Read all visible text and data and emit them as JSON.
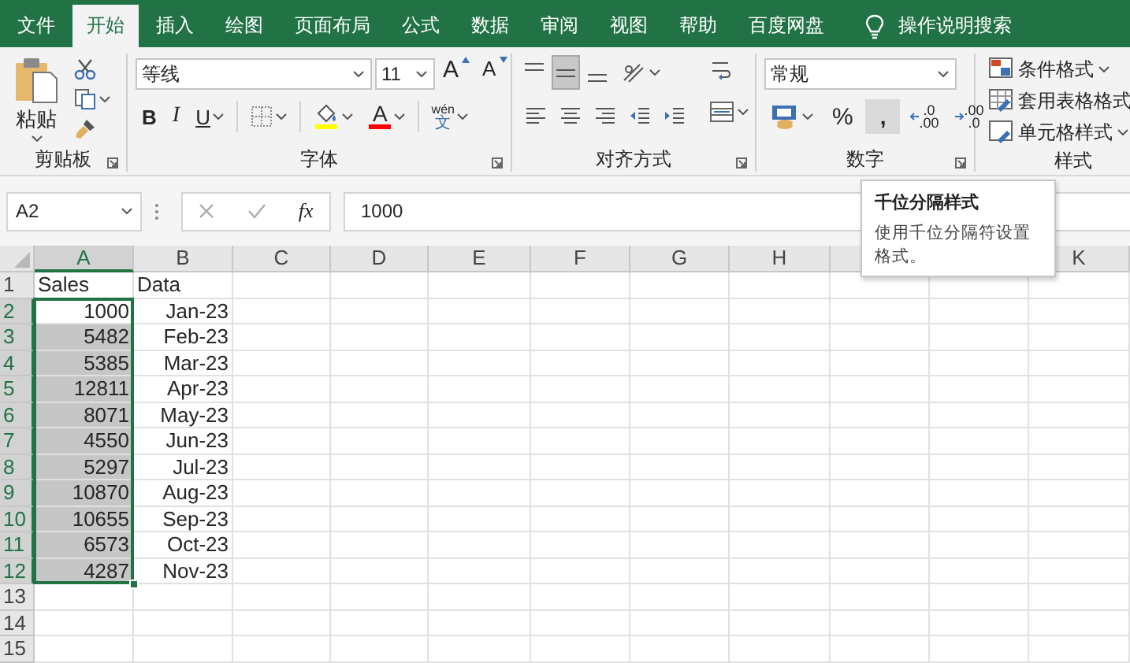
{
  "tabs": [
    {
      "label": "文件",
      "selected": false
    },
    {
      "label": "开始",
      "selected": true
    },
    {
      "label": "插入",
      "selected": false
    },
    {
      "label": "绘图",
      "selected": false
    },
    {
      "label": "页面布局",
      "selected": false
    },
    {
      "label": "公式",
      "selected": false
    },
    {
      "label": "数据",
      "selected": false
    },
    {
      "label": "审阅",
      "selected": false
    },
    {
      "label": "视图",
      "selected": false
    },
    {
      "label": "帮助",
      "selected": false
    },
    {
      "label": "百度网盘",
      "selected": false
    }
  ],
  "search": {
    "label": "操作说明搜索"
  },
  "clipboard": {
    "label": "剪贴板",
    "paste": "粘贴"
  },
  "font": {
    "label": "字体",
    "font_name": "等线",
    "font_size": "11",
    "grow": "A",
    "shrink": "A",
    "bold": "B",
    "italic": "I",
    "underline": "U",
    "font_color": "A",
    "phonetic": [
      "wén",
      "文"
    ]
  },
  "alignment": {
    "label": "对齐方式",
    "vertical_align": [
      {
        "selected": false
      },
      {
        "selected": true
      },
      {
        "selected": false
      }
    ],
    "horizontal_align": [
      {
        "selected": false
      },
      {
        "selected": false
      },
      {
        "selected": false
      }
    ]
  },
  "number": {
    "label": "数字",
    "format": "常规",
    "percent": "%",
    "comma": {
      "text": ",",
      "hovered": true
    },
    "increase_decimal": [
      ".0",
      ".00"
    ],
    "decrease_decimal": [
      ".00",
      ".0"
    ]
  },
  "styles": {
    "label": "样式",
    "items": [
      "条件格式",
      "套用表格格式",
      "单元格样式"
    ]
  },
  "name_box": "A2",
  "fx": "fx",
  "formula": "1000",
  "tooltip": {
    "title": "千位分隔样式",
    "body": "使用千位分隔符设置格式。"
  },
  "sheet": {
    "columns": [
      {
        "label": "A",
        "selected": true
      },
      {
        "label": "B",
        "selected": false
      },
      {
        "label": "C",
        "selected": false
      },
      {
        "label": "D",
        "selected": false
      },
      {
        "label": "E",
        "selected": false
      },
      {
        "label": "F",
        "selected": false
      },
      {
        "label": "G",
        "selected": false
      },
      {
        "label": "H",
        "selected": false
      }
    ],
    "last_column": "K",
    "rows": [
      {
        "number": "1",
        "selected": false,
        "active": false,
        "kind": "text",
        "cells": [
          "Sales",
          "Data"
        ]
      },
      {
        "number": "2",
        "selected": true,
        "active": true,
        "kind": "value",
        "cells": [
          "1000",
          "Jan-23"
        ]
      },
      {
        "number": "3",
        "selected": true,
        "active": false,
        "kind": "value",
        "cells": [
          "5482",
          "Feb-23"
        ]
      },
      {
        "number": "4",
        "selected": true,
        "active": false,
        "kind": "value",
        "cells": [
          "5385",
          "Mar-23"
        ]
      },
      {
        "number": "5",
        "selected": true,
        "active": false,
        "kind": "value",
        "cells": [
          "12811",
          "Apr-23"
        ]
      },
      {
        "number": "6",
        "selected": true,
        "active": false,
        "kind": "value",
        "cells": [
          "8071",
          "May-23"
        ]
      },
      {
        "number": "7",
        "selected": true,
        "active": false,
        "kind": "value",
        "cells": [
          "4550",
          "Jun-23"
        ]
      },
      {
        "number": "8",
        "selected": true,
        "active": false,
        "kind": "value",
        "cells": [
          "5297",
          "Jul-23"
        ]
      },
      {
        "number": "9",
        "selected": true,
        "active": false,
        "kind": "value",
        "cells": [
          "10870",
          "Aug-23"
        ]
      },
      {
        "number": "10",
        "selected": true,
        "active": false,
        "kind": "value",
        "cells": [
          "10655",
          "Sep-23"
        ]
      },
      {
        "number": "11",
        "selected": true,
        "active": false,
        "kind": "value",
        "cells": [
          "6573",
          "Oct-23"
        ]
      },
      {
        "number": "12",
        "selected": true,
        "active": false,
        "kind": "value",
        "cells": [
          "4287",
          "Nov-23"
        ]
      },
      {
        "number": "13",
        "selected": false,
        "active": false,
        "kind": "value"
      },
      {
        "number": "14",
        "selected": false,
        "active": false,
        "kind": "value"
      },
      {
        "number": "15",
        "selected": false,
        "active": false,
        "kind": "value"
      }
    ]
  }
}
